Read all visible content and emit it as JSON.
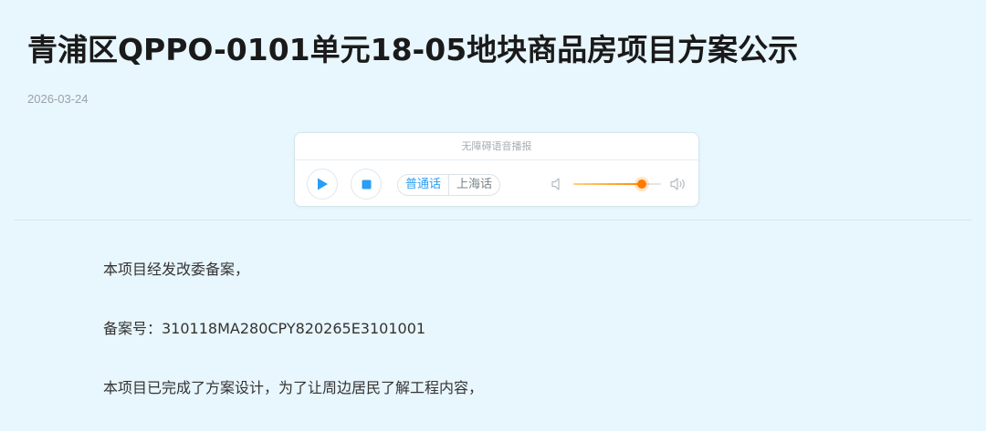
{
  "article": {
    "title": "青浦区QPPO-0101单元18-05地块商品房项目方案公示",
    "date": "2026-03-24"
  },
  "audio_player": {
    "header": "无障碍语音播报",
    "languages": {
      "mandarin": "普通话",
      "shanghainese": "上海话",
      "selected": "普通话"
    },
    "volume_level": 0.78,
    "accent_color": "#2a9df4",
    "volume_color": "#ff8a00"
  },
  "content": {
    "paragraphs": [
      "本项目经发改委备案，",
      "备案号：310118MA280CPY820265E3101001",
      "本项目已完成了方案设计，为了让周边居民了解工程内容，"
    ]
  }
}
